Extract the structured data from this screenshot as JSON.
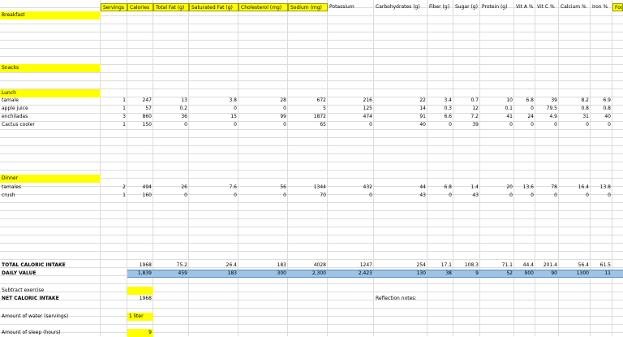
{
  "headers": [
    "Servings",
    "Calories",
    "Total Fat (g)",
    "Saturated Fat (g)",
    "Cholesterol (mg)",
    "Sodium (mg)",
    "Potassium",
    "Carbohydrates (g)",
    "Fiber (g)",
    "Sugar (g)",
    "Protein (g)",
    "Vit A %",
    "Vit C %",
    "Calcium %",
    "Iron %",
    "Foo"
  ],
  "sections": {
    "breakfast": "Breakfast",
    "snacks": "Snacks",
    "lunch": "Lunch",
    "dinner": "Dinner"
  },
  "lunch_rows": [
    {
      "name": "tamale",
      "values": [
        "1",
        "247",
        "13",
        "3.8",
        "28",
        "672",
        "216",
        "22",
        "3.4",
        "0.7",
        "10",
        "6.8",
        "39",
        "8.2",
        "6.9"
      ]
    },
    {
      "name": "apple juice",
      "values": [
        "1",
        "57",
        "0.2",
        "0",
        "0",
        "5",
        "125",
        "14",
        "0.3",
        "12",
        "0.1",
        "0",
        "79.5",
        "0.8",
        "0.8"
      ]
    },
    {
      "name": "enchiladas",
      "values": [
        "3",
        "860",
        "36",
        "15",
        "99",
        "1872",
        "474",
        "91",
        "6.6",
        "7.2",
        "41",
        "24",
        "4.9",
        "31",
        "40"
      ]
    },
    {
      "name": "Cactus cooler",
      "values": [
        "1",
        "150",
        "0",
        "0",
        "0",
        "65",
        "0",
        "40",
        "0",
        "39",
        "0",
        "0",
        "0",
        "0",
        "0"
      ]
    }
  ],
  "dinner_rows": [
    {
      "name": "tamales",
      "values": [
        "2",
        "494",
        "26",
        "7.6",
        "56",
        "1344",
        "432",
        "44",
        "6.8",
        "1.4",
        "20",
        "13.6",
        "78",
        "16.4",
        "13.8"
      ]
    },
    {
      "name": "crush",
      "values": [
        "1",
        "160",
        "0",
        "0",
        "0",
        "70",
        "0",
        "43",
        "0",
        "43",
        "0",
        "0",
        "0",
        "0",
        "0"
      ]
    }
  ],
  "totals": {
    "label": "TOTAL CALORIC INTAKE",
    "values": [
      "",
      "1968",
      "75.2",
      "26.4",
      "183",
      "4028",
      "1247",
      "254",
      "17.1",
      "108.3",
      "71.1",
      "44.4",
      "201.4",
      "56.4",
      "61.5"
    ]
  },
  "daily": {
    "label": "DAILY VALUE",
    "values": [
      "",
      "1,839",
      "459",
      "183",
      "300",
      "2,300",
      "2,423",
      "130",
      "38",
      "9",
      "52",
      "900",
      "90",
      "1300",
      "11"
    ]
  },
  "footer": {
    "subtract_label": "Subtract exercise",
    "net_label": "NET CALORIC INTAKE",
    "net_value": "1968",
    "reflection_label": "Reflection notes:",
    "water_label": "Amount of water (servings)",
    "water_value": "1 liter",
    "sleep_label": "Amount of sleep (hours)",
    "sleep_value": "9"
  },
  "colors": {
    "highlight": "#ffff00",
    "daily_row": "#9dc3e6"
  }
}
